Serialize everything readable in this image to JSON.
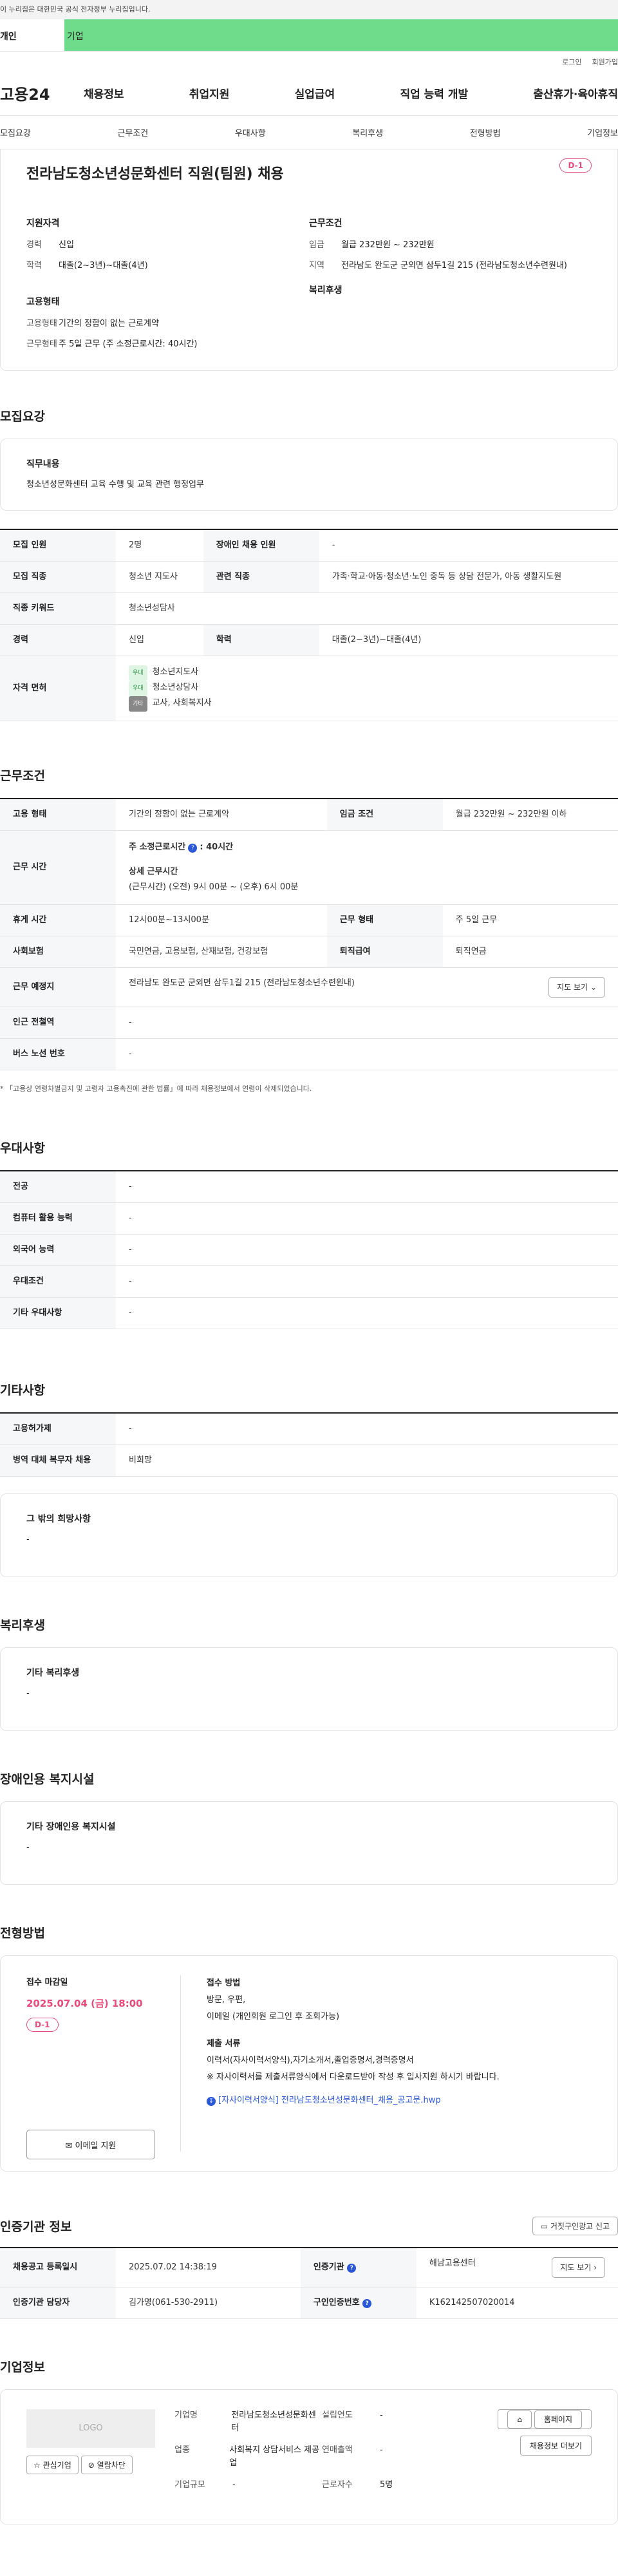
{
  "gov_banner": "이 누리집은 대한민국 공식 전자정부 누리집입니다.",
  "member_tabs": {
    "individual": "개인",
    "business": "기업"
  },
  "top_links": [
    "로그인",
    "회원가입"
  ],
  "brand": "고용24",
  "gnb": [
    "채용정보",
    "취업지원",
    "실업급여",
    "직업 능력 개발",
    "출산휴가·육아휴직"
  ],
  "subnav": [
    "모집요강",
    "근무조건",
    "우대사항",
    "복리후생",
    "전형방법",
    "기업정보"
  ],
  "job": {
    "title": "전라남도청소년성문화센터 직원(팀원) 채용",
    "dday": "D-1",
    "qual_heading": "지원자격",
    "career_k": "경력",
    "career_v": "신입",
    "edu_k": "학력",
    "edu_v": "대졸(2~3년)~대졸(4년)",
    "emp_heading": "고용형태",
    "emp_k": "고용형태",
    "emp_v": "기간의 정함이 없는 근로계약",
    "work_k": "근무형태",
    "work_v": "주 5일 근무 (주 소정근로시간: 40시간)",
    "cond_heading": "근무조건",
    "wage_k": "임금",
    "wage_v": "월급 232만원 ~ 232만원",
    "region_k": "지역",
    "region_v": "전라남도 완도군 군외면 삼두1길 215 (전라남도청소년수련원내)",
    "welfare_heading": "복리후생"
  },
  "recruit": {
    "title": "모집요강",
    "duty_heading": "직무내용",
    "duty_text": "청소년성문화센터 교육 수행 및 교육 관련 행정업무",
    "rows": {
      "people_k": "모집 인원",
      "people_v": "2명",
      "disabled_k": "장애인 채용 인원",
      "disabled_v": "-",
      "jobtype_k": "모집 직종",
      "jobtype_v": "청소년 지도사",
      "related_k": "관련 직종",
      "related_v": "가족·학교·아동·청소년·노인 중독 등 상담 전문가, 아동 생활지도원",
      "code_k": "직종 키워드",
      "code_v": "청소년성담사",
      "career_k": "경력",
      "career_v": "신입",
      "edu_k": "학력",
      "edu_v": "대졸(2~3년)~대졸(4년)",
      "license_k": "자격 면허",
      "licenses": [
        {
          "tag": "우대",
          "name": "청소년지도사"
        },
        {
          "tag": "우대",
          "name": "청소년상담사"
        },
        {
          "tag": "기타",
          "name": "교사, 사회복지사"
        }
      ]
    }
  },
  "work": {
    "title": "근무조건",
    "emp_k": "고용 형태",
    "emp_v": "기간의 정함이 없는 근로계약",
    "wage_k": "임금 조건",
    "wage_v": "월급 232만원 ~ 232만원 이하",
    "hours_k": "근무 시간",
    "hours_week_label": "주 소정근로시간",
    "hours_week_val": ": 40시간",
    "hours_detail_label": "상세 근무시간",
    "hours_detail_val": "(근무시간) (오전) 9시 00분 ~ (오후) 6시 00분",
    "break_k": "휴게 시간",
    "break_v": "12시00분~13시00분",
    "form_k": "근무 형태",
    "form_v": "주 5일 근무",
    "ins_k": "사회보험",
    "ins_v": "국민연금, 고용보험, 산재보험, 건강보험",
    "sev_k": "퇴직급여",
    "sev_v": "퇴직연금",
    "place_k": "근무 예정지",
    "place_v": "전라남도 완도군 군외면 삼두1길 215 (전라남도청소년수련원내)",
    "map_btn": "지도 보기",
    "subway_k": "인근 전철역",
    "subway_v": "-",
    "bus_k": "버스 노선 번호",
    "bus_v": "-",
    "note": "* 「고용상 연령차별금지 및 고령자 고용촉진에 관한 법률」에 따라 채용정보에서 연령이 삭제되었습니다."
  },
  "pref": {
    "title": "우대사항",
    "rows": [
      {
        "k": "전공",
        "v": "-"
      },
      {
        "k": "컴퓨터 활용 능력",
        "v": "-"
      },
      {
        "k": "외국어 능력",
        "v": "-"
      },
      {
        "k": "우대조건",
        "v": "-"
      },
      {
        "k": "기타 우대사항",
        "v": "-"
      }
    ]
  },
  "etc": {
    "title": "기타사항",
    "rows": [
      {
        "k": "고용허가제",
        "v": "-"
      },
      {
        "k": "병역 대체 복무자 채용",
        "v": "비희망"
      }
    ],
    "box_title": "그 밖의 희망사항",
    "box_val": "-"
  },
  "welfare": {
    "title": "복리후생",
    "box_title": "기타 복리후생",
    "box_val": "-"
  },
  "disab": {
    "title": "장애인용 복지시설",
    "box_title": "기타 장애인용 복지시설",
    "box_val": "-"
  },
  "selection": {
    "title": "전형방법",
    "deadline_label": "접수 마감일",
    "deadline": "2025.07.04 (금) 18:00",
    "dday": "D-1",
    "email_btn": "이메일 지원",
    "method_label": "접수 방법",
    "method_v1": "방문, 우편,",
    "method_v2": "이메일 (개인회원 로그인 후 조회가능)",
    "docs_label": "제출 서류",
    "docs_v1": "이력서(자사이력서양식),자기소개서,졸업증명서,경력증명서",
    "docs_v2": "※ 자사이력서를 제출서류양식에서 다운로드받아 작성 후 입사지원 하시기 바랍니다.",
    "file": "[자사이력서양식] 전라남도청소년성문화센터_채용_공고문.hwp"
  },
  "cert": {
    "title": "인증기관 정보",
    "report_btn": "거짓구인광고 신고",
    "date_k": "채용공고 등록일시",
    "date_v": "2025.07.02 14:38:19",
    "org_k": "인증기관",
    "org_v": "해남고용센터",
    "map_btn": "지도 보기",
    "staff_k": "인증기관 담당자",
    "staff_v": "김가영(061-530-2911)",
    "num_k": "구인인증번호",
    "num_v": "K162142507020014"
  },
  "company": {
    "title": "기업정보",
    "logo": "LOGO",
    "fav_btn": "관심기업",
    "block_btn": "열람차단",
    "name_k": "기업명",
    "name_v": "전라남도청소년성문화센터",
    "founded_k": "설립연도",
    "founded_v": "-",
    "ind_k": "업종",
    "ind_v": "사회복지 상담서비스 제공업",
    "sales_k": "연매출액",
    "sales_v": "-",
    "emp_k": "근로자수",
    "emp_v": "5명",
    "size_k": "기업규모",
    "size_v": "-",
    "home_btn": "홈페이지",
    "more_btn": "채용정보 더보기"
  }
}
